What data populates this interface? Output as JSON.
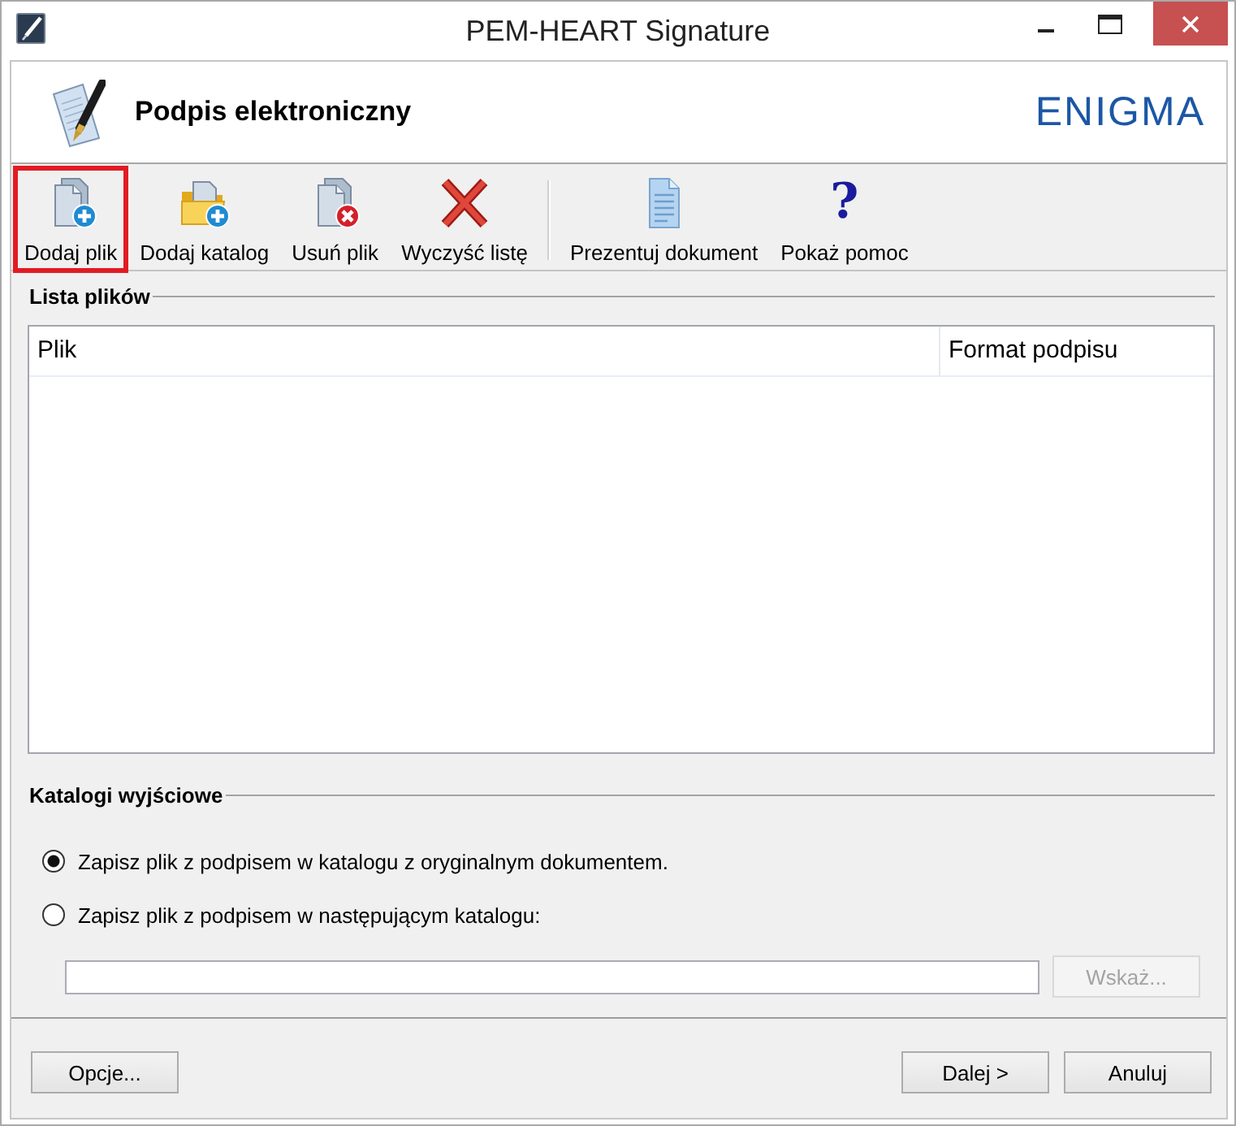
{
  "window": {
    "title": "PEM-HEART Signature"
  },
  "header": {
    "title": "Podpis elektroniczny",
    "logo": "ENIGMA"
  },
  "toolbar": {
    "groups": [
      {
        "items": [
          {
            "label": "Dodaj plik",
            "highlighted": true
          },
          {
            "label": "Dodaj katalog",
            "highlighted": false
          },
          {
            "label": "Usuń plik",
            "highlighted": false
          },
          {
            "label": "Wyczyść listę",
            "highlighted": false
          }
        ]
      },
      {
        "items": [
          {
            "label": "Prezentuj dokument",
            "highlighted": false
          },
          {
            "label": "Pokaż pomoc",
            "glyph": "?",
            "highlighted": false
          }
        ]
      }
    ]
  },
  "file_list": {
    "title": "Lista plików",
    "columns": [
      "Plik",
      "Format podpisu"
    ]
  },
  "output_folders": {
    "title": "Katalogi wyjściowe",
    "options": [
      {
        "label": "Zapisz plik z podpisem w katalogu z oryginalnym dokumentem.",
        "selected": true
      },
      {
        "label": "Zapisz plik z podpisem w następującym katalogu:",
        "selected": false
      }
    ],
    "path_field": {
      "disabled": false
    },
    "browse_button": {
      "label": "Wskaż...",
      "disabled": true
    }
  },
  "footer": {
    "left_buttons": [
      "Opcje..."
    ],
    "right_buttons": [
      "Dalej >",
      "Anuluj"
    ]
  }
}
